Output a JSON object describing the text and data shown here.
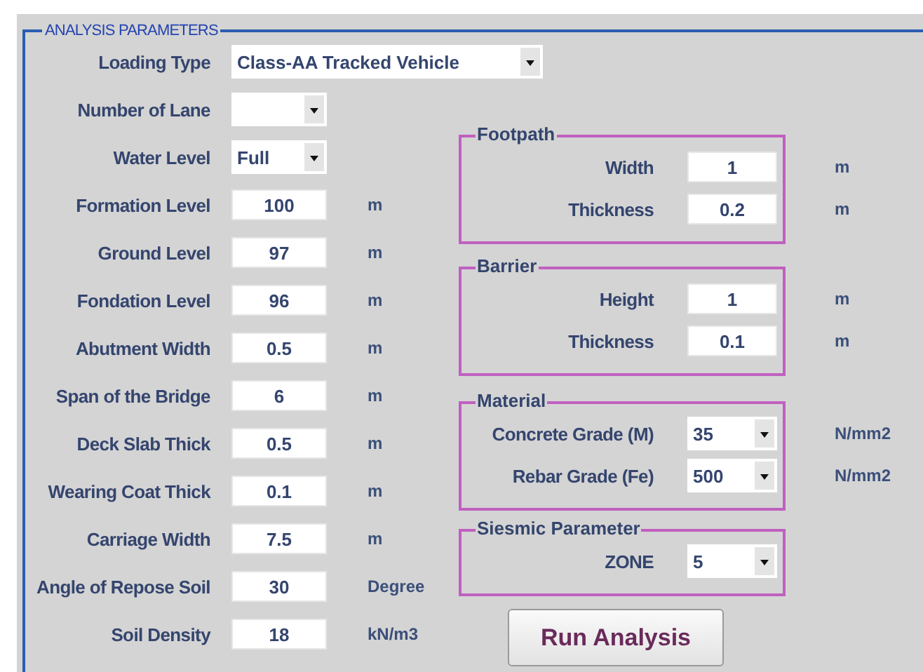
{
  "panel": {
    "title": "ANALYSIS PARAMETERS"
  },
  "loading_type": {
    "label": "Loading Type",
    "kind": "dropdown",
    "value": "Class-AA Tracked Vehicle"
  },
  "parameters": [
    {
      "label": "Number of Lane",
      "kind": "dropdown"
    },
    {
      "label": "Water Level",
      "kind": "dropdown",
      "value": "Full"
    },
    {
      "label": "Formation Level",
      "kind": "field",
      "value": "100",
      "unit": "m"
    },
    {
      "label": "Ground Level",
      "kind": "field",
      "value": "97",
      "unit": "m"
    },
    {
      "label": "Fondation Level",
      "kind": "field",
      "value": "96",
      "unit": "m"
    },
    {
      "label": "Abutment Width",
      "kind": "field",
      "value": "0.5",
      "unit": "m"
    },
    {
      "label": "Span of the Bridge",
      "kind": "field",
      "value": "6",
      "unit": "m"
    },
    {
      "label": "Deck Slab Thick",
      "kind": "field",
      "value": "0.5",
      "unit": "m"
    },
    {
      "label": "Wearing Coat Thick",
      "kind": "field",
      "value": "0.1",
      "unit": "m"
    },
    {
      "label": "Carriage Width",
      "kind": "field",
      "value": "7.5",
      "unit": "m"
    },
    {
      "label": "Angle of Repose Soil",
      "kind": "field",
      "value": "30",
      "unit": "Degree"
    },
    {
      "label": "Soil Density",
      "kind": "field",
      "value": "18",
      "unit": "kN/m3"
    }
  ],
  "groups": [
    {
      "title": "Footpath",
      "rows": [
        {
          "label": "Width",
          "kind": "field",
          "value": "1",
          "unit": "m"
        },
        {
          "label": "Thickness",
          "kind": "field",
          "value": "0.2",
          "unit": "m"
        }
      ]
    },
    {
      "title": "Barrier",
      "rows": [
        {
          "label": "Height",
          "kind": "field",
          "value": "1",
          "unit": "m"
        },
        {
          "label": "Thickness",
          "kind": "field",
          "value": "0.1",
          "unit": "m"
        }
      ]
    },
    {
      "title": "Material",
      "rows": [
        {
          "label": "Concrete Grade (M)",
          "kind": "dropdown",
          "value": "35",
          "unit": "N/mm2"
        },
        {
          "label": "Rebar Grade (Fe)",
          "kind": "dropdown",
          "value": "500",
          "unit": "N/mm2"
        }
      ]
    },
    {
      "title": "Siesmic Parameter",
      "rows": [
        {
          "label": "ZONE",
          "kind": "dropdown",
          "value": "5"
        }
      ]
    }
  ],
  "run_button": "Run Analysis"
}
